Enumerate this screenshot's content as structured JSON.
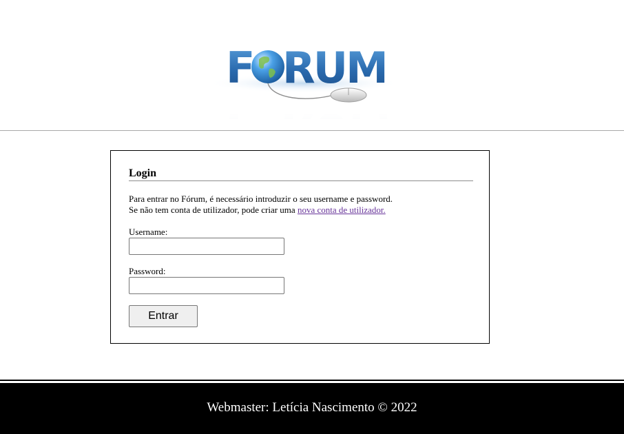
{
  "header": {
    "logo_text": "FORUM"
  },
  "login": {
    "title": "Login",
    "intro_line1": "Para entrar no Fórum, é necessário introduzir o seu username e password.",
    "intro_line2_prefix": "Se não tem conta de utilizador, pode criar uma ",
    "register_link": "nova conta de utilizador.",
    "username_label": "Username:",
    "username_value": "",
    "password_label": "Password:",
    "password_value": "",
    "submit_label": "Entrar"
  },
  "footer": {
    "text": "Webmaster: Letícia Nascimento © 2022"
  },
  "colors": {
    "footer_bg": "#000000",
    "logo_blue": "#2e6fb0",
    "link_visited": "#663399"
  }
}
